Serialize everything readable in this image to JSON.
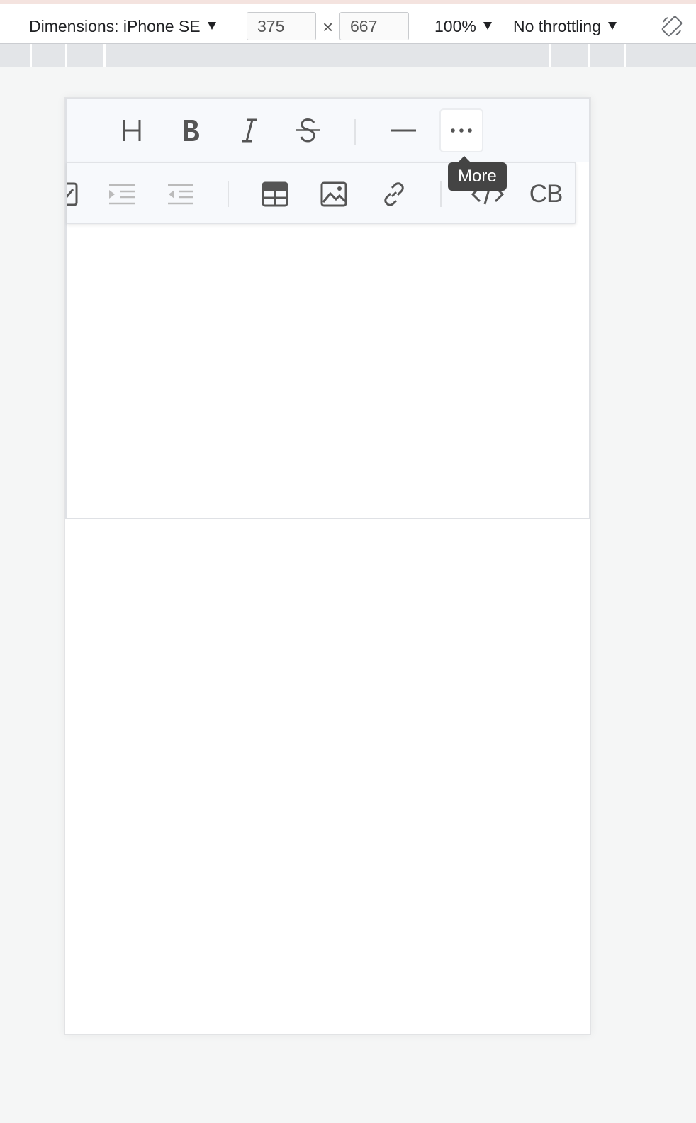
{
  "devtools": {
    "dimensions_label": "Dimensions: iPhone SE",
    "width_value": "375",
    "height_value": "667",
    "times_symbol": "×",
    "zoom_label": "100%",
    "throttling_label": "No throttling"
  },
  "editor": {
    "toolbar": {
      "heading_icon": "heading-icon",
      "bold_icon": "bold-icon",
      "italic_icon": "italic-icon",
      "strike_icon": "strikethrough-icon",
      "hr_icon": "horizontal-rule-icon",
      "more_icon": "more-icon"
    },
    "tooltip": "More",
    "dropdown": {
      "items": [
        "task-icon",
        "indent-icon",
        "outdent-icon",
        "table-icon",
        "image-icon",
        "link-icon",
        "code-icon",
        "codeblock-icon"
      ],
      "codeblock_label": "CB"
    }
  },
  "colors": {
    "toolbar_bg": "#f7f9fc",
    "icon": "#555555",
    "icon_disabled": "#bbbbbb",
    "tooltip_bg": "#444444"
  }
}
